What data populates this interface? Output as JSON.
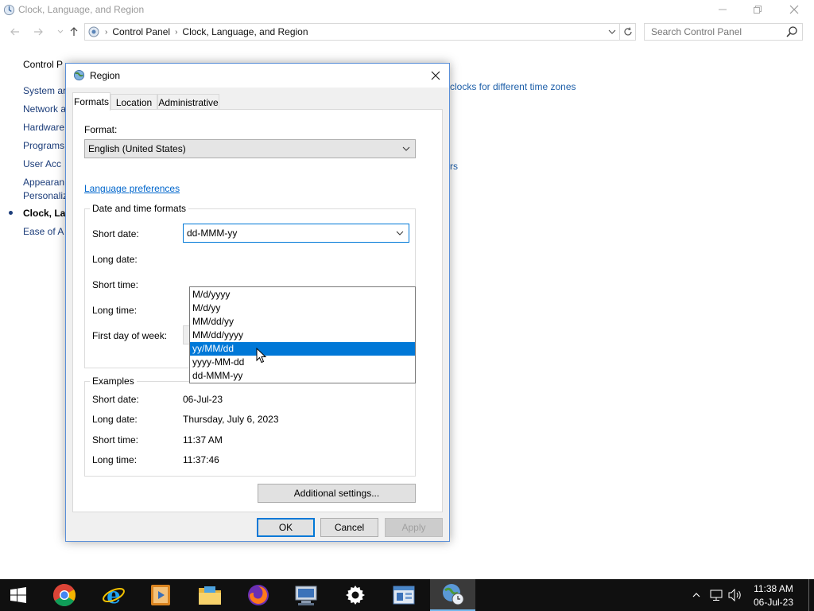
{
  "window": {
    "title": "Clock, Language, and Region",
    "breadcrumbs": [
      "Control Panel",
      "Clock, Language, and Region"
    ],
    "search_placeholder": "Search Control Panel"
  },
  "sidebar": {
    "items": [
      {
        "label": "Control Panel Home",
        "visible": "Control P"
      },
      {
        "label": "System ar"
      },
      {
        "label": "Network a"
      },
      {
        "label": "Hardware"
      },
      {
        "label": "Programs"
      },
      {
        "label": "User Acc"
      },
      {
        "label": "Appearan"
      },
      {
        "label": "Personaliz"
      },
      {
        "label": "Clock, La"
      },
      {
        "label": "Ease of A"
      }
    ]
  },
  "background_links": {
    "clocks": "clocks for different time zones",
    "rs": "rs"
  },
  "dialog": {
    "title": "Region",
    "tabs": [
      "Formats",
      "Location",
      "Administrative"
    ],
    "format_label": "Format:",
    "format_value": "English (United States)",
    "language_link": "Language preferences",
    "date_time_group": "Date and time formats",
    "fields": {
      "short_date_label": "Short date:",
      "short_date_value": "dd-MMM-yy",
      "long_date_label": "Long date:",
      "short_time_label": "Short time:",
      "long_time_label": "Long time:",
      "first_day_label": "First day of week:"
    },
    "dropdown_options": [
      "M/d/yyyy",
      "M/d/yy",
      "MM/dd/yy",
      "MM/dd/yyyy",
      "yy/MM/dd",
      "yyyy-MM-dd",
      "dd-MMM-yy"
    ],
    "highlighted_option": "yy/MM/dd",
    "examples": {
      "title": "Examples",
      "short_date_label": "Short date:",
      "short_date_value": "06-Jul-23",
      "long_date_label": "Long date:",
      "long_date_value": "Thursday, July 6, 2023",
      "short_time_label": "Short time:",
      "short_time_value": "11:37 AM",
      "long_time_label": "Long time:",
      "long_time_value": "11:37:46"
    },
    "additional_settings": "Additional settings...",
    "ok": "OK",
    "cancel": "Cancel",
    "apply": "Apply"
  },
  "taskbar": {
    "time": "11:38 AM",
    "date": "06-Jul-23"
  },
  "colors": {
    "accent": "#0078d7",
    "link": "#0066cc",
    "taskbar": "#101010"
  }
}
